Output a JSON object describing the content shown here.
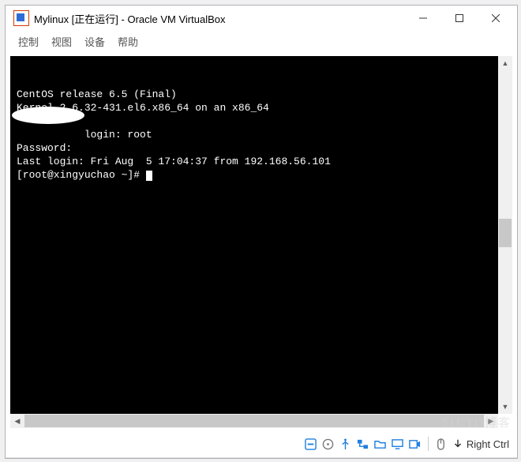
{
  "window": {
    "title": "Mylinux [正在运行] - Oracle VM VirtualBox",
    "menu": {
      "control": "控制",
      "view": "视图",
      "devices": "设备",
      "help": "帮助"
    }
  },
  "terminal": {
    "line1": "CentOS release 6.5 (Final)",
    "line2": "Kernel 2.6.32-431.el6.x86_64 on an x86_64",
    "blank": "",
    "login": "           login: root",
    "password": "Password:",
    "lastlogin": "Last login: Fri Aug  5 17:04:37 from 192.168.56.101",
    "prompt": "[root@xingyuchao ~]# "
  },
  "status": {
    "hostkey": "Right Ctrl"
  },
  "watermark": "51CTO博客"
}
